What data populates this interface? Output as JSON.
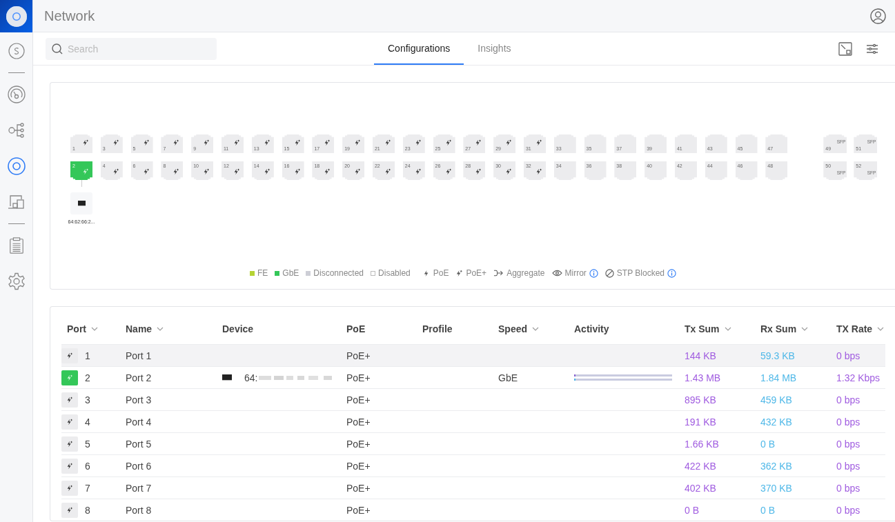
{
  "app": {
    "title": "Network"
  },
  "sidebar": {
    "groups": [
      [
        {
          "kind": "site",
          "selected": false
        }
      ],
      [
        {
          "kind": "dashboard",
          "selected": false
        },
        {
          "kind": "topology",
          "selected": false
        },
        {
          "kind": "device",
          "selected": true
        },
        {
          "kind": "clients",
          "selected": false
        }
      ],
      [
        {
          "kind": "logs",
          "selected": false
        },
        {
          "kind": "settings",
          "selected": false
        }
      ]
    ]
  },
  "search": {
    "placeholder": "Search"
  },
  "tabs": [
    {
      "label": "Configurations",
      "selected": true
    },
    {
      "label": "Insights",
      "selected": false
    }
  ],
  "ports": [
    {
      "number": "1",
      "kind": "poe_plus",
      "connected": false
    },
    {
      "number": "2",
      "kind": "poe_plus",
      "connected": true,
      "device": "64:62:66:2..."
    },
    {
      "number": "3",
      "kind": "poe_plus",
      "connected": false
    },
    {
      "number": "4",
      "kind": "poe_plus",
      "connected": false
    },
    {
      "number": "5",
      "kind": "poe_plus",
      "connected": false
    },
    {
      "number": "6",
      "kind": "poe_plus",
      "connected": false
    },
    {
      "number": "7",
      "kind": "poe_plus",
      "connected": false
    },
    {
      "number": "8",
      "kind": "poe_plus",
      "connected": false
    },
    {
      "number": "9",
      "kind": "poe_plus",
      "connected": false
    },
    {
      "number": "10",
      "kind": "poe_plus",
      "connected": false
    },
    {
      "number": "11",
      "kind": "poe_plus",
      "connected": false
    },
    {
      "number": "12",
      "kind": "poe_plus",
      "connected": false
    },
    {
      "number": "13",
      "kind": "poe_plus",
      "connected": false
    },
    {
      "number": "14",
      "kind": "poe_plus",
      "connected": false
    },
    {
      "number": "15",
      "kind": "poe_plus",
      "connected": false
    },
    {
      "number": "16",
      "kind": "poe_plus",
      "connected": false
    },
    {
      "number": "17",
      "kind": "poe_plus",
      "connected": false
    },
    {
      "number": "18",
      "kind": "poe_plus",
      "connected": false
    },
    {
      "number": "19",
      "kind": "poe_plus",
      "connected": false
    },
    {
      "number": "20",
      "kind": "poe_plus",
      "connected": false
    },
    {
      "number": "21",
      "kind": "poe_plus",
      "connected": false
    },
    {
      "number": "22",
      "kind": "poe_plus",
      "connected": false
    },
    {
      "number": "23",
      "kind": "poe_plus",
      "connected": false
    },
    {
      "number": "24",
      "kind": "poe_plus",
      "connected": false
    },
    {
      "number": "25",
      "kind": "poe_plus",
      "connected": false
    },
    {
      "number": "26",
      "kind": "poe_plus",
      "connected": false
    },
    {
      "number": "27",
      "kind": "poe_plus",
      "connected": false
    },
    {
      "number": "28",
      "kind": "poe_plus",
      "connected": false
    },
    {
      "number": "29",
      "kind": "poe_plus",
      "connected": false
    },
    {
      "number": "30",
      "kind": "poe_plus",
      "connected": false
    },
    {
      "number": "31",
      "kind": "poe_plus",
      "connected": false
    },
    {
      "number": "32",
      "kind": "poe_plus",
      "connected": false
    },
    {
      "number": "33",
      "kind": "plain",
      "connected": false
    },
    {
      "number": "34",
      "kind": "plain",
      "connected": false
    },
    {
      "number": "35",
      "kind": "plain",
      "connected": false
    },
    {
      "number": "36",
      "kind": "plain",
      "connected": false
    },
    {
      "number": "37",
      "kind": "plain",
      "connected": false
    },
    {
      "number": "38",
      "kind": "plain",
      "connected": false
    },
    {
      "number": "39",
      "kind": "plain",
      "connected": false
    },
    {
      "number": "40",
      "kind": "plain",
      "connected": false
    },
    {
      "number": "41",
      "kind": "plain",
      "connected": false
    },
    {
      "number": "42",
      "kind": "plain",
      "connected": false
    },
    {
      "number": "43",
      "kind": "plain",
      "connected": false
    },
    {
      "number": "44",
      "kind": "plain",
      "connected": false
    },
    {
      "number": "45",
      "kind": "plain",
      "connected": false
    },
    {
      "number": "46",
      "kind": "plain",
      "connected": false
    },
    {
      "number": "47",
      "kind": "plain",
      "connected": false
    },
    {
      "number": "48",
      "kind": "plain",
      "connected": false
    },
    {
      "number": "49",
      "kind": "sfp",
      "connected": false,
      "tag": "SFP"
    },
    {
      "number": "50",
      "kind": "sfp",
      "connected": false,
      "tag": "SFP"
    },
    {
      "number": "51",
      "kind": "sfp",
      "connected": false,
      "tag": "SFP"
    },
    {
      "number": "52",
      "kind": "sfp",
      "connected": false,
      "tag": "SFP"
    }
  ],
  "legend": [
    {
      "label": "FE",
      "kind": "swatch",
      "color": "#b5d334"
    },
    {
      "label": "GbE",
      "kind": "swatch",
      "color": "#34c759"
    },
    {
      "label": "Disconnected",
      "kind": "swatch",
      "color": "#cdced6"
    },
    {
      "label": "Disabled",
      "kind": "empty"
    },
    {
      "label": "PoE",
      "kind": "poe"
    },
    {
      "label": "PoE+",
      "kind": "poe_plus"
    },
    {
      "label": "Aggregate",
      "kind": "aggregate"
    },
    {
      "label": "Mirror",
      "kind": "mirror",
      "info": true
    },
    {
      "label": "STP Blocked",
      "kind": "stp",
      "info": true
    }
  ],
  "table": {
    "columns": [
      {
        "label": "Port",
        "sortable": true
      },
      {
        "label": "Name",
        "sortable": true
      },
      {
        "label": "Device",
        "sortable": false
      },
      {
        "label": "PoE",
        "sortable": false
      },
      {
        "label": "Profile",
        "sortable": false
      },
      {
        "label": "Speed",
        "sortable": true
      },
      {
        "label": "Activity",
        "sortable": false
      },
      {
        "label": "Tx Sum",
        "sortable": true
      },
      {
        "label": "Rx Sum",
        "sortable": true
      },
      {
        "label": "TX Rate",
        "sortable": true
      }
    ],
    "rows": [
      {
        "port": "1",
        "connected": false,
        "highlighted": true,
        "name": "Port 1",
        "poe": "PoE+",
        "tx_sum": "144 KB",
        "rx_sum": "59.3 KB",
        "tx_rate": "0 bps"
      },
      {
        "port": "2",
        "connected": true,
        "highlighted": false,
        "name": "Port 2",
        "device": "64:",
        "poe": "PoE+",
        "speed": "GbE",
        "activity": true,
        "tx_sum": "1.43 MB",
        "rx_sum": "1.84 MB",
        "tx_rate": "1.32 Kbps"
      },
      {
        "port": "3",
        "connected": false,
        "highlighted": false,
        "name": "Port 3",
        "poe": "PoE+",
        "tx_sum": "895 KB",
        "rx_sum": "459 KB",
        "tx_rate": "0 bps"
      },
      {
        "port": "4",
        "connected": false,
        "highlighted": false,
        "name": "Port 4",
        "poe": "PoE+",
        "tx_sum": "191 KB",
        "rx_sum": "432 KB",
        "tx_rate": "0 bps"
      },
      {
        "port": "5",
        "connected": false,
        "highlighted": false,
        "name": "Port 5",
        "poe": "PoE+",
        "tx_sum": "1.66 KB",
        "rx_sum": "0 B",
        "tx_rate": "0 bps"
      },
      {
        "port": "6",
        "connected": false,
        "highlighted": false,
        "name": "Port 6",
        "poe": "PoE+",
        "tx_sum": "422 KB",
        "rx_sum": "362 KB",
        "tx_rate": "0 bps"
      },
      {
        "port": "7",
        "connected": false,
        "highlighted": false,
        "name": "Port 7",
        "poe": "PoE+",
        "tx_sum": "402 KB",
        "rx_sum": "370 KB",
        "tx_rate": "0 bps"
      },
      {
        "port": "8",
        "connected": false,
        "highlighted": false,
        "name": "Port 8",
        "poe": "PoE+",
        "tx_sum": "0 B",
        "rx_sum": "0 B",
        "tx_rate": "0 bps"
      }
    ]
  }
}
